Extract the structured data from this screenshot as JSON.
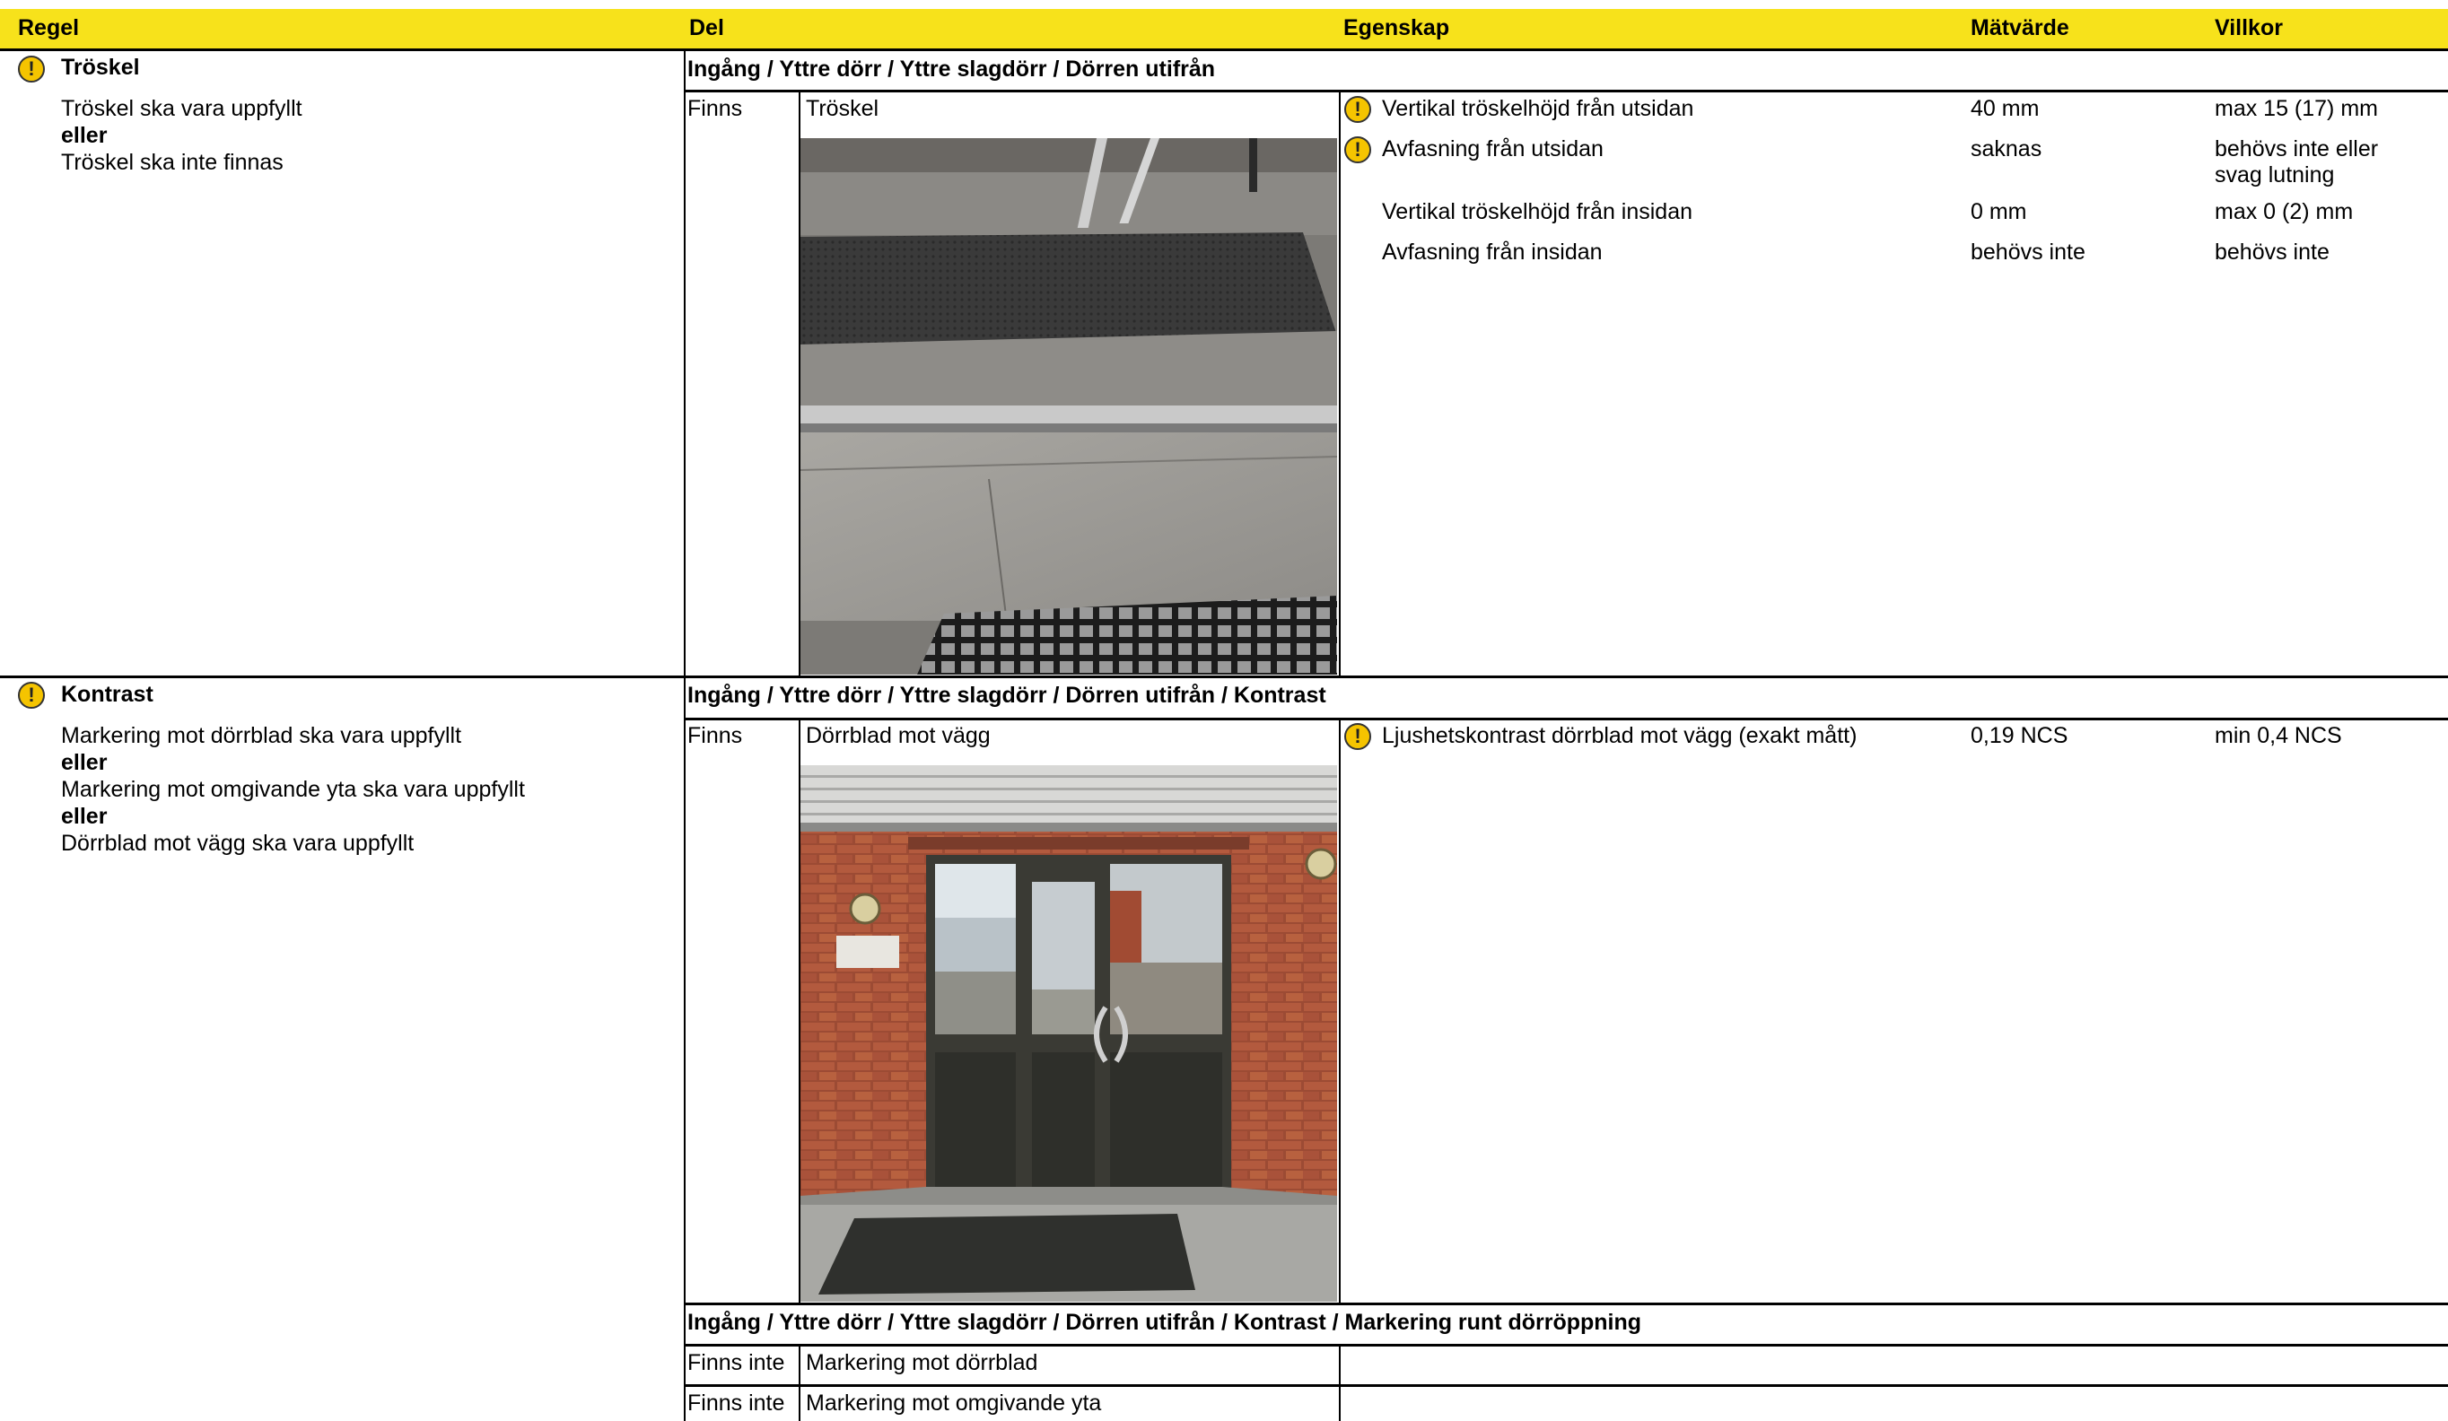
{
  "header": {
    "regel": "Regel",
    "del": "Del",
    "egenskap": "Egenskap",
    "matvarde": "Mätvärde",
    "villkor": "Villkor"
  },
  "rule1": {
    "title": "Tröskel",
    "line1": "Tröskel ska vara uppfyllt",
    "or1": "eller",
    "line2": "Tröskel ska inte finnas",
    "path": "Ingång / Yttre dörr / Yttre slagdörr  / Dörren utifrån",
    "status": "Finns",
    "part": "Tröskel",
    "props": [
      {
        "name": "Vertikal tröskelhöjd från utsidan",
        "value": "40 mm",
        "cond": "max 15 (17) mm"
      },
      {
        "name": "Avfasning från utsidan",
        "value": "saknas",
        "cond": "behövs inte eller",
        "cond2": "svag lutning"
      },
      {
        "name": "Vertikal tröskelhöjd från insidan",
        "value": "0 mm",
        "cond": "max 0 (2) mm"
      },
      {
        "name": "Avfasning från insidan",
        "value": "behövs inte",
        "cond": "behövs inte"
      }
    ]
  },
  "rule2": {
    "title": "Kontrast",
    "line1": "Markering mot dörrblad ska vara uppfyllt",
    "or1": "eller",
    "line2": "Markering mot omgivande yta ska vara uppfyllt",
    "or2": "eller",
    "line3": "Dörrblad mot vägg ska vara uppfyllt",
    "path": "Ingång / Yttre dörr / Yttre slagdörr  / Dörren utifrån / Kontrast",
    "status": "Finns",
    "part": "Dörrblad mot vägg",
    "props": [
      {
        "name": "Ljushetskontrast dörrblad mot vägg (exakt mått)",
        "value": "0,19 NCS",
        "cond": "min 0,4 NCS"
      }
    ],
    "path2": "Ingång / Yttre dörr / Yttre slagdörr  / Dörren utifrån / Kontrast / Markering runt dörröppning",
    "sub": [
      {
        "status": "Finns inte",
        "part": "Markering mot dörrblad"
      },
      {
        "status": "Finns inte",
        "part": "Markering mot omgivande yta"
      }
    ]
  },
  "icons": {
    "warning": "exclamation-warning-icon",
    "warning_color": "#f5c400",
    "header_color": "#f7e21b"
  }
}
